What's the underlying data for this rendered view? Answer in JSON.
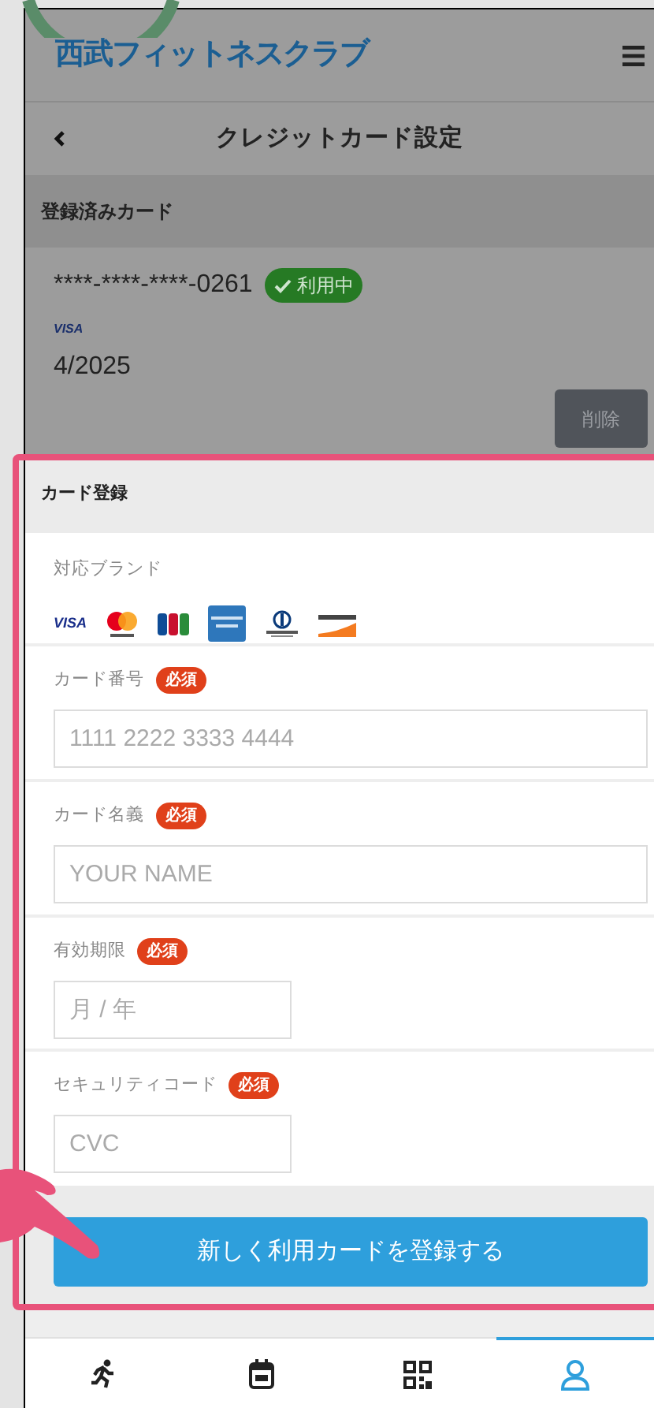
{
  "header": {
    "logo": "西武フィットネスクラブ"
  },
  "page_title": "クレジットカード設定",
  "registered_cards": {
    "heading": "登録済みカード",
    "cards": [
      {
        "number": "****-****-****-0261",
        "status": "利用中",
        "in_use": true,
        "brand": "VISA",
        "expiry": "4/2025",
        "delete_label": "削除"
      }
    ]
  },
  "registration": {
    "heading": "カード登録",
    "brands_label": "対応ブランド",
    "brands": [
      {
        "kind": "visa",
        "label": "VISA"
      },
      {
        "kind": "mastercard"
      },
      {
        "kind": "jcb"
      },
      {
        "kind": "amex"
      },
      {
        "kind": "diners"
      },
      {
        "kind": "discover"
      }
    ],
    "fields": [
      {
        "label": "カード番号",
        "badge": "必須",
        "placeholder": "1111 2222 3333 4444",
        "kind": "wide"
      },
      {
        "label": "カード名義",
        "badge": "必須",
        "placeholder": "YOUR NAME",
        "kind": "wide"
      },
      {
        "label": "有効期限",
        "badge": "必須",
        "placeholder": "月 / 年",
        "kind": "short"
      },
      {
        "label": "セキュリティコード",
        "badge": "必須",
        "placeholder": "CVC",
        "kind": "short"
      }
    ],
    "submit": "新しく利用カードを登録する"
  },
  "bottom_nav": [
    {
      "kind": "run",
      "selected": false
    },
    {
      "kind": "calendar",
      "selected": false
    },
    {
      "kind": "qr",
      "selected": false
    },
    {
      "kind": "person",
      "selected": true
    }
  ]
}
